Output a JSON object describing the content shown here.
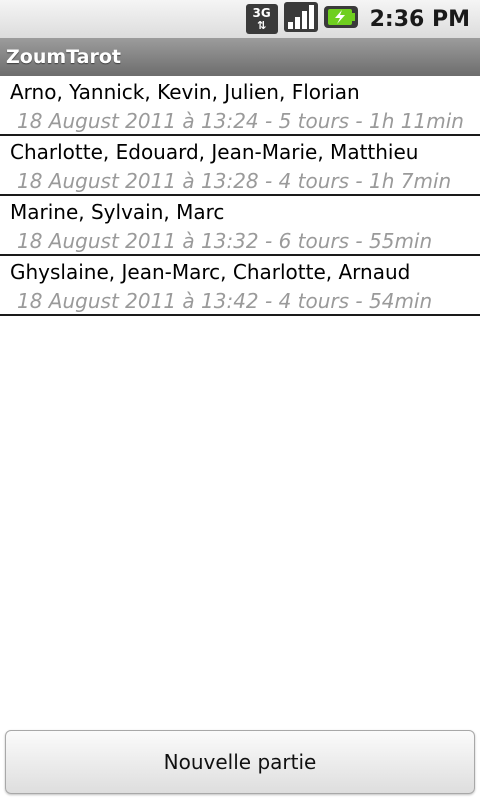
{
  "status_bar": {
    "network_label": "3G",
    "network_icon": "3g-data-icon",
    "signal_icon": "signal-strength-icon",
    "battery_icon": "battery-charging-icon",
    "time": "2:36 PM"
  },
  "app": {
    "title": "ZoumTarot"
  },
  "games": [
    {
      "players": "Arno, Yannick, Kevin, Julien, Florian",
      "meta": "18 August 2011 à 13:24  -  5 tours  -  1h 11min"
    },
    {
      "players": "Charlotte, Edouard, Jean-Marie, Matthieu",
      "meta": "18 August 2011 à 13:28  -  4 tours  -  1h 7min"
    },
    {
      "players": "Marine, Sylvain, Marc",
      "meta": "18 August 2011 à 13:32  -  6 tours  -  55min"
    },
    {
      "players": "Ghyslaine, Jean-Marc, Charlotte, Arnaud",
      "meta": "18 August 2011 à 13:42  -  4 tours  -  54min"
    }
  ],
  "new_game_button": {
    "label": "Nouvelle partie"
  },
  "colors": {
    "title_bar": "#7f7f7f",
    "meta_text": "#9a9a9a",
    "battery_green": "#6fcf1f"
  }
}
